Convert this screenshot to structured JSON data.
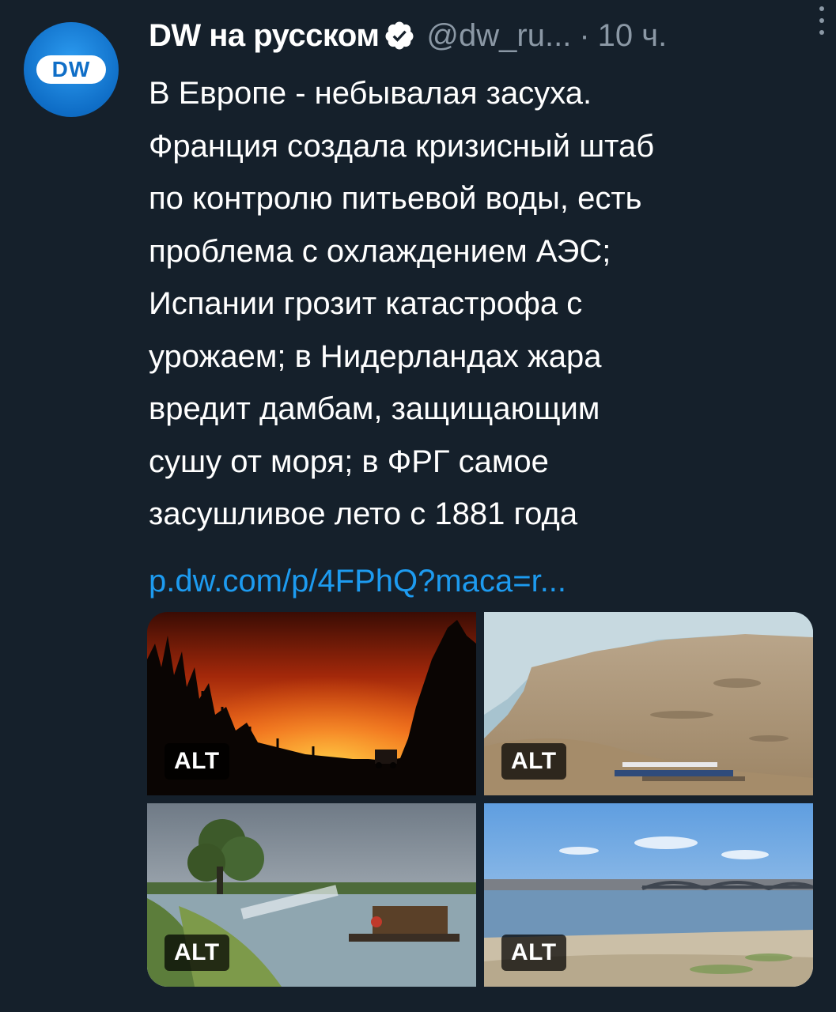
{
  "tweet": {
    "author_name": "DW на русском",
    "author_handle": "@dw_ru...",
    "separator": "·",
    "time": "10 ч.",
    "avatar_text": "DW",
    "body": "В Европе - небывалая засуха.\nФранция создала кризисный штаб\nпо контролю питьевой воды, есть\nпроблема с охлаждением АЭС;\nИспании грозит катастрофа с\nурожаем; в Нидерландах жара\nвредит дамбам, защищающим\nсушу от моря; в ФРГ самое\nзасушливое лето с 1881 года",
    "link": "p.dw.com/p/4FPhQ?maca=r..."
  },
  "media": {
    "alt_label": "ALT",
    "images": [
      {
        "description_icon": "forest-fire-photo"
      },
      {
        "description_icon": "dried-riverbed-photo"
      },
      {
        "description_icon": "irrigation-boat-photo"
      },
      {
        "description_icon": "low-river-bridge-photo"
      }
    ]
  },
  "colors": {
    "background": "#15202b",
    "text": "#ffffff",
    "secondary": "#8b98a5",
    "link": "#1d9bf0",
    "verified": "#ffffff"
  }
}
